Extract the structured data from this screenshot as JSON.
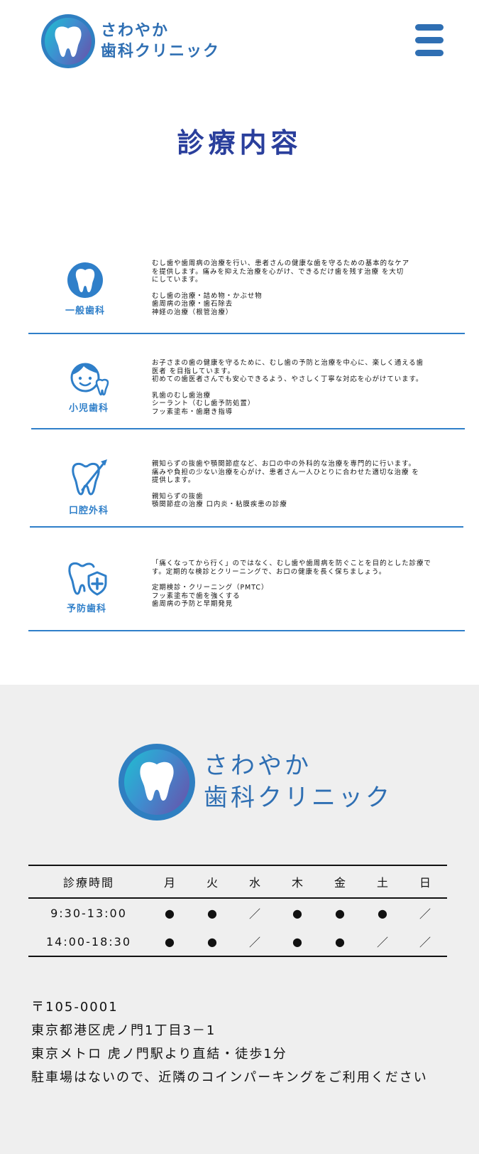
{
  "header": {
    "logo_line1": "さわやか",
    "logo_line2": "歯科クリニック"
  },
  "page_title": "診療内容",
  "services": [
    {
      "label": "一般歯科",
      "icon": "tooth-icon",
      "description": "むし歯や歯周病の治療を行い、患者さんの健康な歯を守るための基本的なケア\nを提供します。痛みを抑えた治療を心がけ、できるだけ歯を残す治療 を大切\nにしています。",
      "items": [
        "むし歯の治療・詰め物・かぶせ物",
        "歯周病の治療・歯石除去",
        "神経の治療（根管治療）"
      ]
    },
    {
      "label": "小児歯科",
      "icon": "child-tooth-icon",
      "description": "お子さまの歯の健康を守るために、むし歯の予防と治療を中心に、楽しく通える歯\n医者 を目指しています。\n初めての歯医者さんでも安心できるよう、やさしく丁寧な対応を心がけています。",
      "items": [
        "乳歯のむし歯治療",
        "シーラント（むし歯予防処置）",
        "フッ素塗布・歯磨き指導"
      ]
    },
    {
      "label": "口腔外科",
      "icon": "tooth-scalpel-icon",
      "description": "親知らずの抜歯や顎関節症など、お口の中の外科的な治療を専門的に行います。\n痛みや負担の少ない治療を心がけ、患者さん一人ひとりに合わせた適切な治療 を\n提供します。",
      "items": [
        "親知らずの抜歯",
        "顎関節症の治療 口内炎・粘膜疾患の診療"
      ]
    },
    {
      "label": "予防歯科",
      "icon": "tooth-shield-icon",
      "description": "「痛くなってから行く」のではなく、むし歯や歯周病を防ぐことを目的とした診療で\nす。定期的な検診とクリーニングで、お口の健康を長く保ちましょう。",
      "items": [
        "定期検診・クリーニング（PMTC）",
        "フッ素塗布で歯を強くする",
        "歯周病の予防と早期発見"
      ]
    }
  ],
  "footer": {
    "logo_line1": "さわやか",
    "logo_line2": "歯科クリニック",
    "hours": {
      "header": [
        "診療時間",
        "月",
        "火",
        "水",
        "木",
        "金",
        "土",
        "日"
      ],
      "rows": [
        {
          "time": "9:30-13:00",
          "marks": [
            "●",
            "●",
            "／",
            "●",
            "●",
            "●",
            "／"
          ]
        },
        {
          "time": "14:00-18:30",
          "marks": [
            "●",
            "●",
            "／",
            "●",
            "●",
            "／",
            "／"
          ]
        }
      ]
    },
    "address": [
      "〒105-0001",
      "東京都港区虎ノ門1丁目3－1",
      "東京メトロ 虎ノ門駅より直結・徒歩1分",
      "駐車場はないので、近隣のコインパーキングをご利用ください"
    ]
  },
  "colors": {
    "brand_blue": "#2f6fb3",
    "accent_blue": "#2f7fc9",
    "title_navy": "#2a3f9c",
    "footer_bg": "#efefef"
  }
}
